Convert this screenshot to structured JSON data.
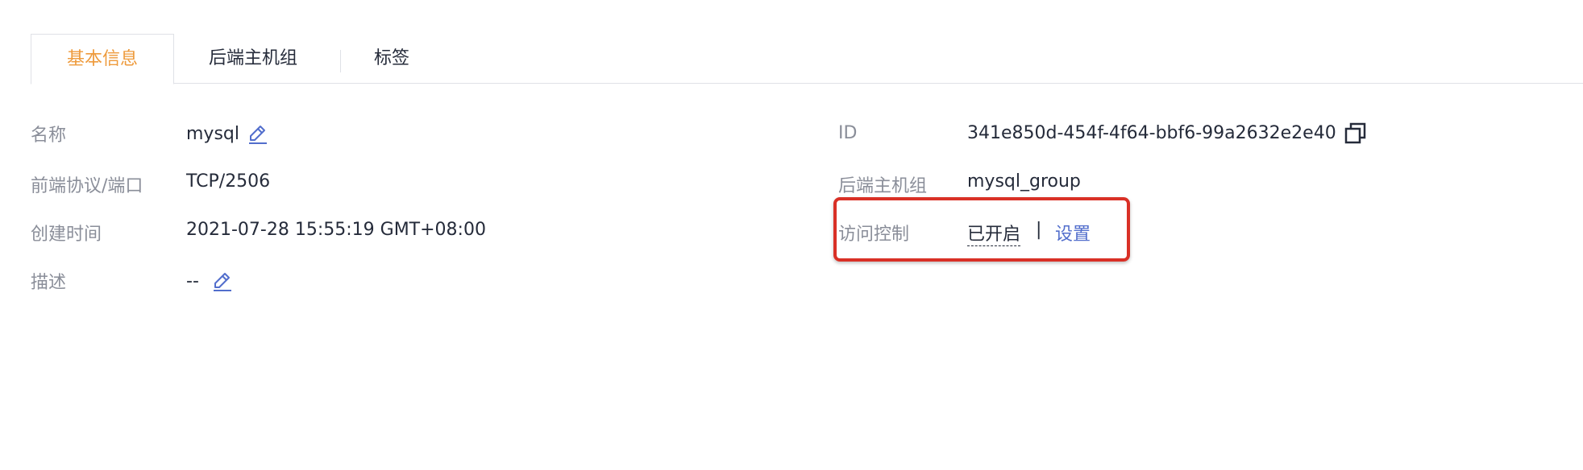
{
  "tabs": [
    {
      "label": "基本信息",
      "active": true
    },
    {
      "label": "后端主机组",
      "active": false
    },
    {
      "label": "标签",
      "active": false
    }
  ],
  "left": {
    "name_label": "名称",
    "name_value": "mysql",
    "protocol_label": "前端协议/端口",
    "protocol_value": "TCP/2506",
    "created_label": "创建时间",
    "created_value": "2021-07-28 15:55:19 GMT+08:00",
    "desc_label": "描述",
    "desc_value": "--"
  },
  "right": {
    "id_label": "ID",
    "id_value": "341e850d-454f-4f64-bbf6-99a2632e2e40",
    "group_label": "后端主机组",
    "group_value": "mysql_group",
    "acl_label": "访问控制",
    "acl_status": "已开启",
    "acl_separator": "|",
    "acl_link": "设置"
  },
  "icons": {
    "edit": "pencil-edit-icon",
    "copy": "copy-icon"
  },
  "colors": {
    "active_tab": "#ee9a3b",
    "link": "#526ecc",
    "label": "#8a8e99",
    "highlight": "#d93026"
  }
}
